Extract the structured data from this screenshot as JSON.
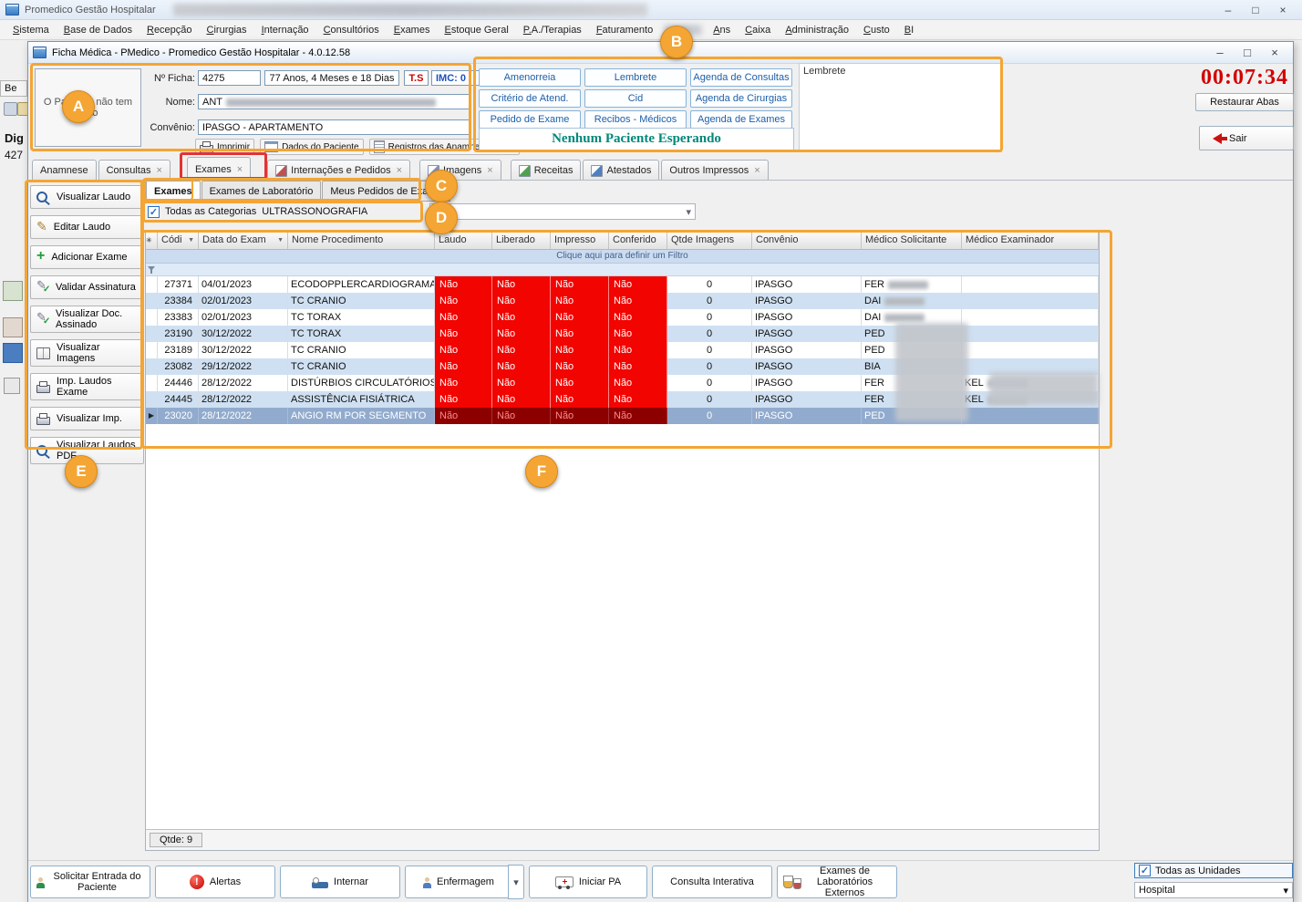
{
  "app": {
    "title": "Promedico Gestão Hospitalar",
    "menu_items": [
      "Sistema",
      "Base de Dados",
      "Recepção",
      "Cirurgias",
      "Internação",
      "Consultórios",
      "Exames",
      "Estoque Geral",
      "P.A./Terapias",
      "Faturamento",
      "Ans",
      "Caixa",
      "Administração",
      "Custo",
      "BI"
    ]
  },
  "background_fragments": {
    "tab": "Be",
    "label1": "Dig",
    "label2": "427"
  },
  "window": {
    "title": "Ficha Médica - PMedico - Promedico Gestão Hospitalar - 4.0.12.58"
  },
  "patient": {
    "photo_placeholder": "O Paciente não tem Foto",
    "ficha_label": "Nº Ficha:",
    "ficha": "4275",
    "idade": "77 Anos, 4 Meses e 18 Dias",
    "ts": "T.S",
    "imc": "IMC: 0",
    "nome_label": "Nome:",
    "nome_prefix": "ANT",
    "convenio_label": "Convênio:",
    "convenio": "IPASGO - APARTAMENTO",
    "actions": {
      "imprimir": "Imprimir",
      "dados": "Dados do Paciente",
      "registros": "Registros das Anamneses (Log"
    }
  },
  "quick_panel": {
    "buttons": [
      "Amenorreia",
      "Lembrete",
      "Agenda de Consultas",
      "Critério de Atend.",
      "Cid",
      "Agenda de Cirurgias",
      "Pedido de Exame",
      "Recibos - Médicos",
      "Agenda de Exames"
    ],
    "status": "Nenhum Paciente Esperando",
    "lembrete_label": "Lembrete"
  },
  "session": {
    "timer": "00:07:34",
    "restaurar_abas": "Restaurar Abas",
    "sair": "Sair"
  },
  "tabs": [
    {
      "label": "Anamnese"
    },
    {
      "label": "Consultas",
      "closable": true
    },
    {
      "label": "Exames",
      "closable": true,
      "selected": true
    },
    {
      "label": "Internações e Pedidos",
      "closable": true
    },
    {
      "label": "Imagens",
      "closable": true
    },
    {
      "label": "Receitas"
    },
    {
      "label": "Atestados"
    },
    {
      "label": "Outros Impressos",
      "closable": true
    }
  ],
  "subtabs": [
    "Exames",
    "Exames de Laboratório",
    "Meus Pedidos de Exame"
  ],
  "filters": {
    "todas_categorias": "Todas as Categorias",
    "categoria": "ULTRASSONOGRAFIA"
  },
  "sidebar": [
    "Visualizar Laudo",
    "Editar Laudo",
    "Adicionar Exame",
    "Validar Assinatura",
    "Visualizar Doc. Assinado",
    "Visualizar Imagens",
    "Imp. Laudos Exame",
    "Visualizar Imp.",
    "Visualizar Laudos PDF"
  ],
  "grid": {
    "filter_hint": "Clique aqui para definir um Filtro",
    "columns": [
      "Códi",
      "Data do Exam",
      "Nome Procedimento",
      "Laudo",
      "Liberado",
      "Impresso",
      "Conferido",
      "Qtde Imagens",
      "Convênio",
      "Médico Solicitante",
      "Médico Examinador"
    ],
    "rows": [
      {
        "codigo": "27371",
        "data": "04/01/2023",
        "nome": "ECODOPPLERCARDIOGRAMA",
        "laudo": "Não",
        "liberado": "Não",
        "impresso": "Não",
        "conferido": "Não",
        "qtde_imagens": "0",
        "convenio": "IPASGO",
        "solicitante": "FER",
        "examinador": ""
      },
      {
        "codigo": "23384",
        "data": "02/01/2023",
        "nome": "TC CRANIO",
        "laudo": "Não",
        "liberado": "Não",
        "impresso": "Não",
        "conferido": "Não",
        "qtde_imagens": "0",
        "convenio": "IPASGO",
        "solicitante": "DAI",
        "examinador": ""
      },
      {
        "codigo": "23383",
        "data": "02/01/2023",
        "nome": "TC TORAX",
        "laudo": "Não",
        "liberado": "Não",
        "impresso": "Não",
        "conferido": "Não",
        "qtde_imagens": "0",
        "convenio": "IPASGO",
        "solicitante": "DAI",
        "examinador": ""
      },
      {
        "codigo": "23190",
        "data": "30/12/2022",
        "nome": "TC TORAX",
        "laudo": "Não",
        "liberado": "Não",
        "impresso": "Não",
        "conferido": "Não",
        "qtde_imagens": "0",
        "convenio": "IPASGO",
        "solicitante": "PED",
        "examinador": ""
      },
      {
        "codigo": "23189",
        "data": "30/12/2022",
        "nome": "TC CRANIO",
        "laudo": "Não",
        "liberado": "Não",
        "impresso": "Não",
        "conferido": "Não",
        "qtde_imagens": "0",
        "convenio": "IPASGO",
        "solicitante": "PED",
        "examinador": ""
      },
      {
        "codigo": "23082",
        "data": "29/12/2022",
        "nome": "TC CRANIO",
        "laudo": "Não",
        "liberado": "Não",
        "impresso": "Não",
        "conferido": "Não",
        "qtde_imagens": "0",
        "convenio": "IPASGO",
        "solicitante": "BIA",
        "examinador": ""
      },
      {
        "codigo": "24446",
        "data": "28/12/2022",
        "nome": "DISTÚRBIOS CIRCULATÓRIOS",
        "laudo": "Não",
        "liberado": "Não",
        "impresso": "Não",
        "conferido": "Não",
        "qtde_imagens": "0",
        "convenio": "IPASGO",
        "solicitante": "FER",
        "examinador": "KEL"
      },
      {
        "codigo": "24445",
        "data": "28/12/2022",
        "nome": "ASSISTÊNCIA FISIÁTRICA",
        "laudo": "Não",
        "liberado": "Não",
        "impresso": "Não",
        "conferido": "Não",
        "qtde_imagens": "0",
        "convenio": "IPASGO",
        "solicitante": "FER",
        "examinador": "KEL"
      },
      {
        "codigo": "23020",
        "data": "28/12/2022",
        "nome": "ANGIO RM POR SEGMENTO",
        "laudo": "Não",
        "liberado": "Não",
        "impresso": "Não",
        "conferido": "Não",
        "qtde_imagens": "0",
        "convenio": "IPASGO",
        "solicitante": "PED",
        "examinador": "",
        "selected": true
      }
    ],
    "qtde": "Qtde: 9"
  },
  "bottom_toolbar": [
    "Solicitar Entrada do Paciente",
    "Alertas",
    "Internar",
    "Enfermagem",
    "Iniciar PA",
    "Consulta Interativa",
    "Exames de Laboratórios Externos"
  ],
  "units": {
    "todas_unidades": "Todas as Unidades",
    "unidade": "Hospital"
  },
  "icons": {
    "close": "×",
    "dropdown": "▾",
    "check": "✓",
    "sort": "▼",
    "row_marker": "▶",
    "grid_corner": "✳",
    "minimize": "–",
    "maximize": "□",
    "close_win": "×"
  },
  "annotations": {
    "a": "A",
    "b": "B",
    "c": "C",
    "d": "D",
    "e": "E",
    "f": "F"
  }
}
